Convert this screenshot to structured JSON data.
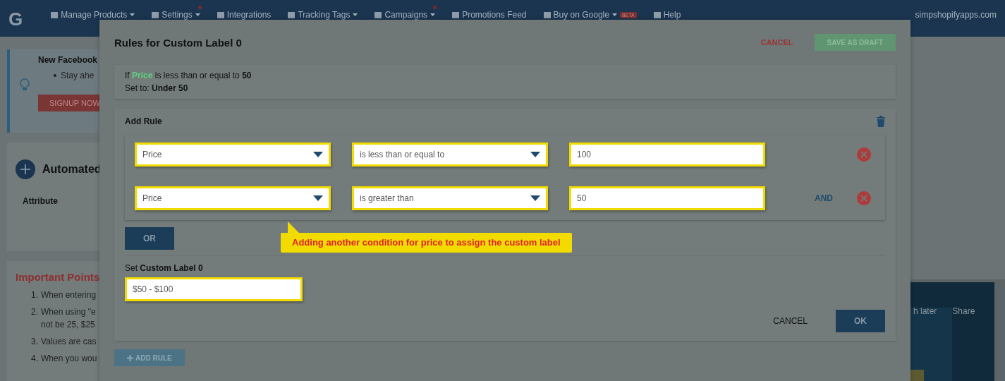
{
  "nav": {
    "logo": "G",
    "items": [
      {
        "label": "Manage Products",
        "dropdown": true,
        "dot": false
      },
      {
        "label": "Settings",
        "dropdown": true,
        "dot": true
      },
      {
        "label": "Integrations",
        "dropdown": false,
        "dot": false
      },
      {
        "label": "Tracking Tags",
        "dropdown": true,
        "dot": false
      },
      {
        "label": "Campaigns",
        "dropdown": true,
        "dot": true
      },
      {
        "label": "Promotions Feed",
        "dropdown": false,
        "dot": false
      },
      {
        "label": "Buy on Google",
        "dropdown": true,
        "dot": false,
        "badge": "BETA"
      },
      {
        "label": "Help",
        "dropdown": false,
        "dot": false
      }
    ],
    "account": "simpshopifyapps.com"
  },
  "banner": {
    "title": "New Facebook",
    "bullet": "Stay ahe",
    "button": "SIGNUP NOW"
  },
  "automated": {
    "title": "Automated",
    "column": "Attribute"
  },
  "important": {
    "title": "Important Points",
    "items": [
      {
        "number": "1.",
        "lines": [
          "When entering"
        ]
      },
      {
        "number": "2.",
        "lines": [
          "When using \"e",
          "not be 25, $25"
        ]
      },
      {
        "number": "3.",
        "lines": [
          "Values are cas"
        ]
      },
      {
        "number": "4.",
        "lines": [
          "When you wou"
        ]
      }
    ]
  },
  "video": {
    "actions": [
      "h later",
      "Share"
    ]
  },
  "dialog": {
    "title": "Rules for Custom Label 0",
    "cancel": "CANCEL",
    "save_draft": "SAVE AS DRAFT",
    "summary": {
      "if_word": "If",
      "field": "Price",
      "operator": "is less than or equal to",
      "value": "50",
      "set_word": "Set to:",
      "set_value": "Under 50"
    },
    "rule": {
      "title": "Add Rule",
      "rows": [
        {
          "field": "Price",
          "operator": "is less than or equal to",
          "value": "100"
        },
        {
          "field": "Price",
          "operator": "is greater than",
          "value": "50",
          "connector": "AND"
        }
      ],
      "or_button": "OR",
      "callout": "Adding another condition for price to assign the custom label",
      "set_prefix": "Set",
      "set_name": "Custom Label 0",
      "label_value": "$50 - $100",
      "cancel": "CANCEL",
      "ok": "OK"
    },
    "add_rule": "ADD RULE"
  }
}
